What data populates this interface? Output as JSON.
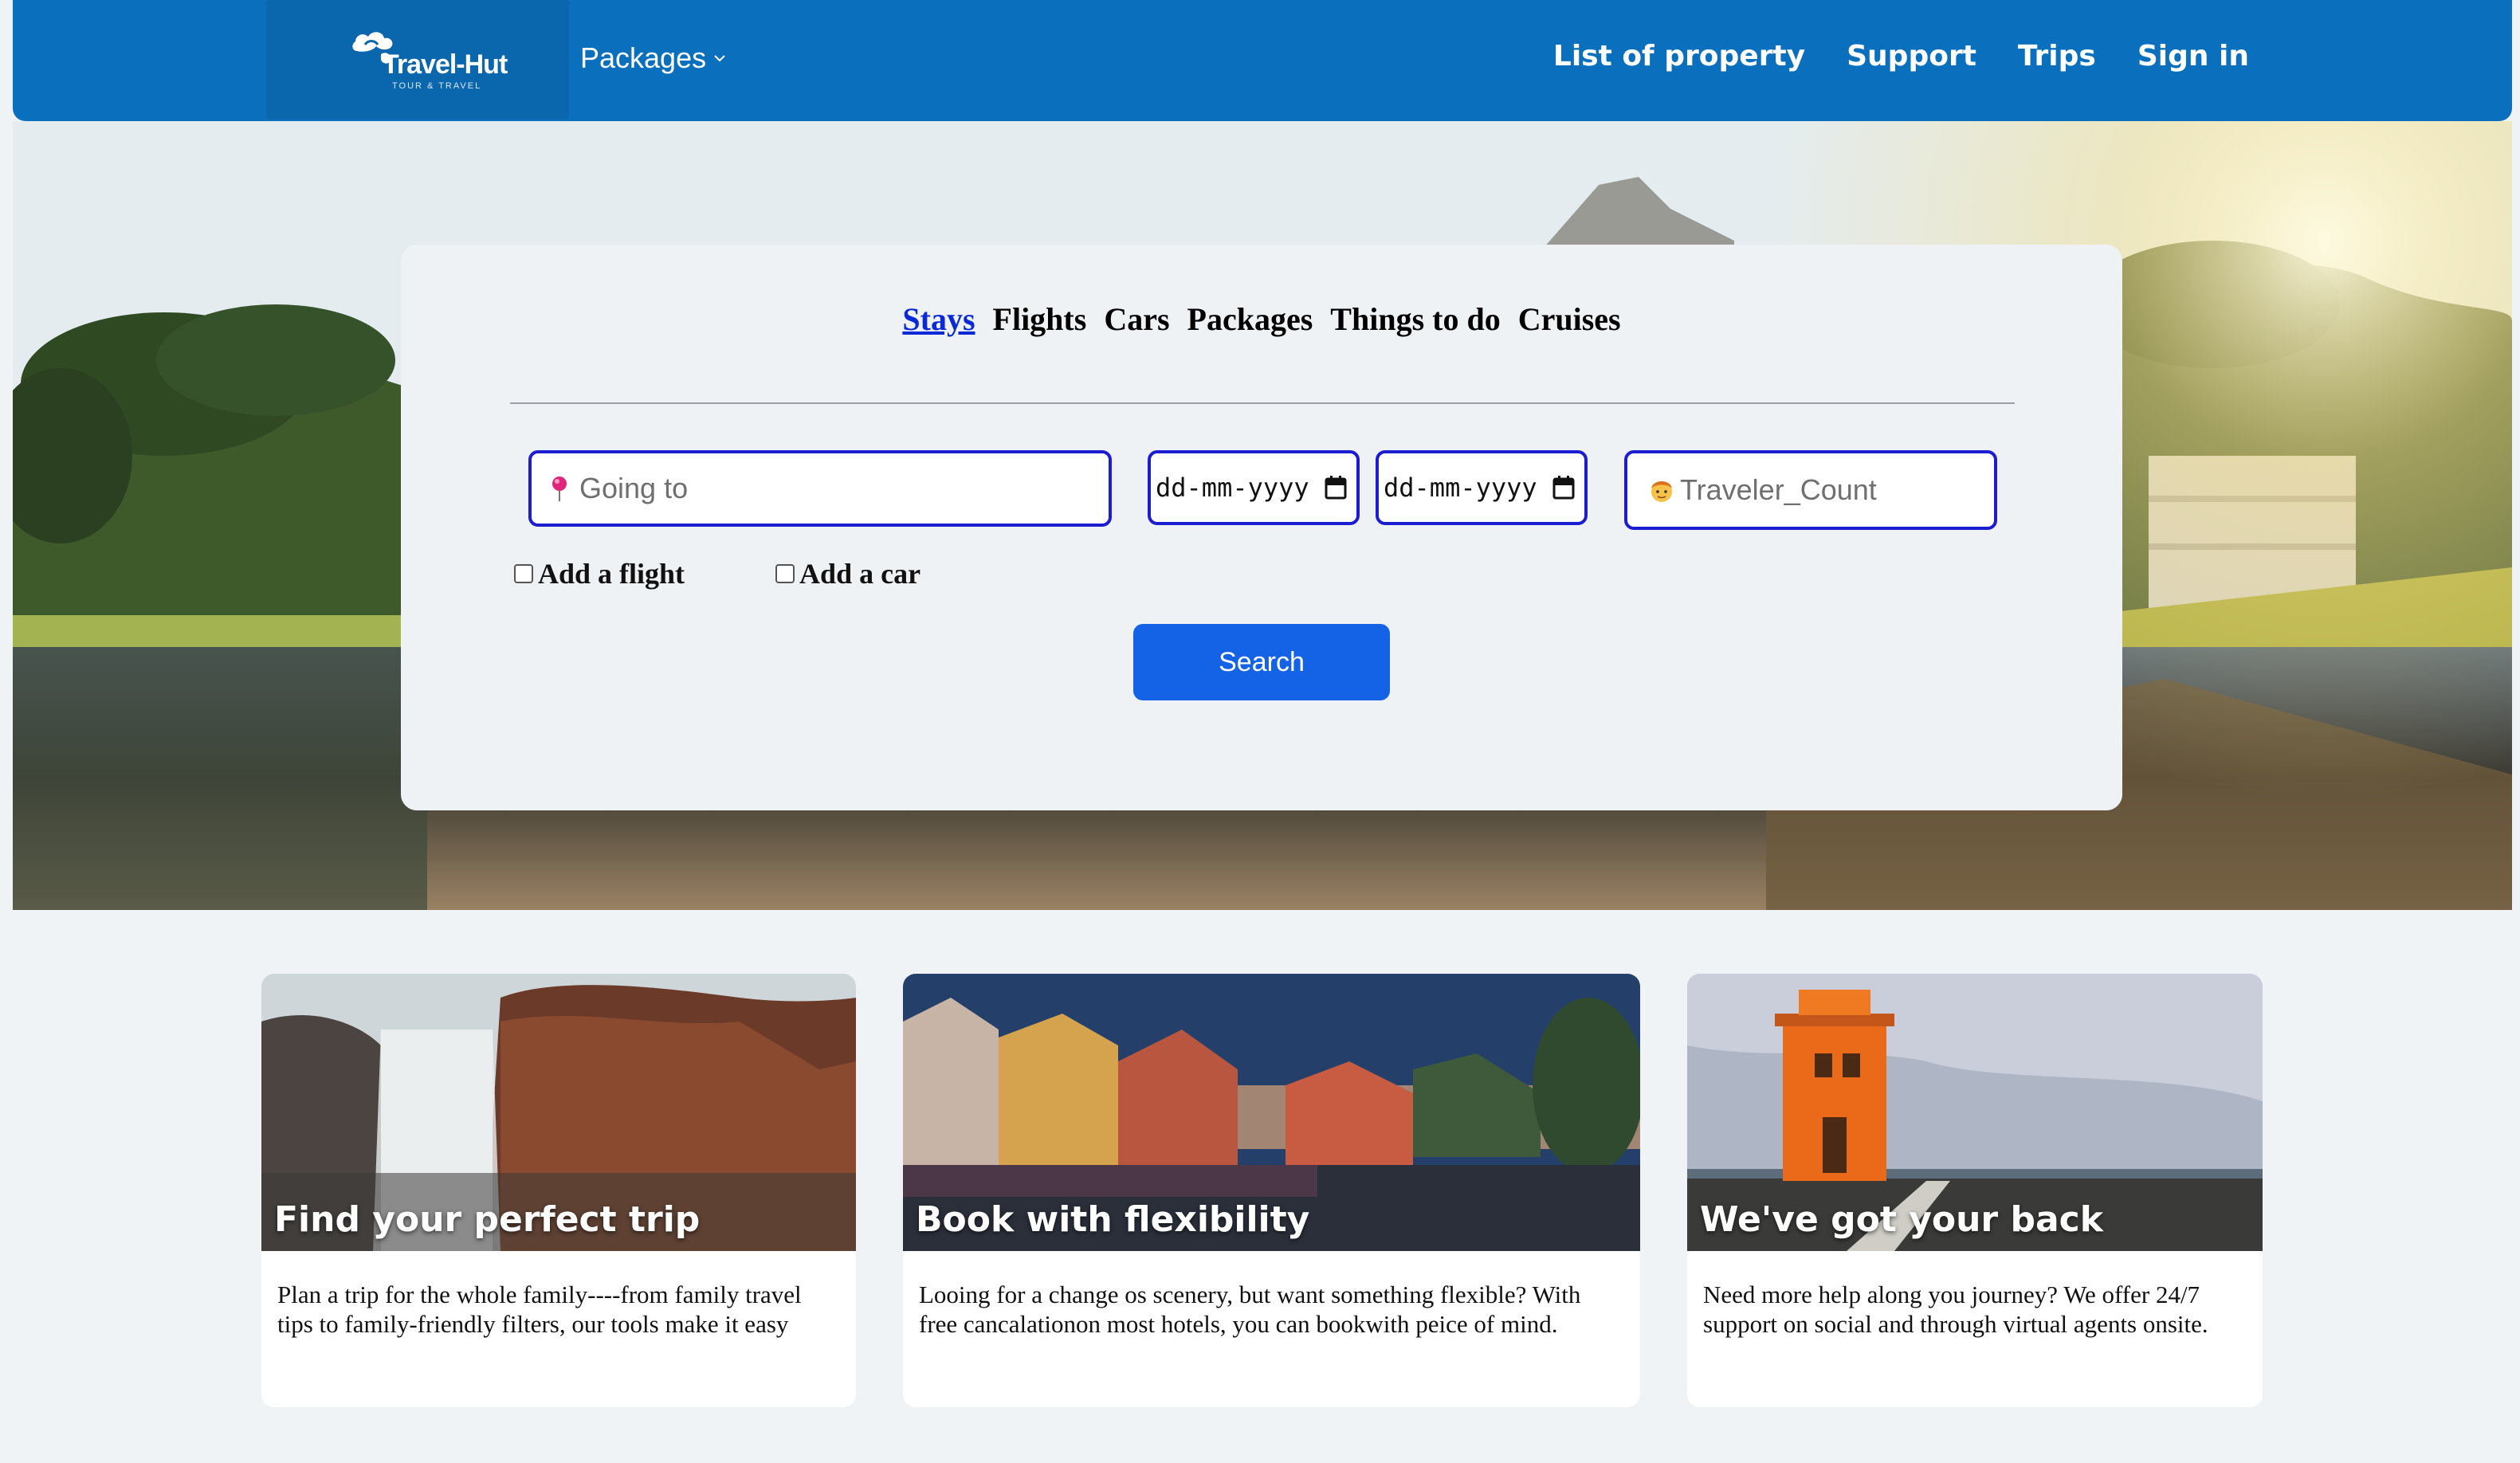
{
  "header": {
    "logo_text": "Travel-Hut",
    "logo_subtext": "TOUR & TRAVEL",
    "packages_label": "Packages",
    "nav_links": [
      "List of property",
      "Support",
      "Trips",
      "Sign in"
    ]
  },
  "search": {
    "tabs": [
      "Stays",
      "Flights",
      "Cars",
      "Packages",
      "Things to do",
      "Cruises"
    ],
    "active_tab": "Stays",
    "going_placeholder": "Going to",
    "date_placeholder_1": "dd-mm-yyyy",
    "date_placeholder_2": "dd-mm-yyyy",
    "traveler_placeholder": "Traveler_Count",
    "add_flight_label": "Add a flight",
    "add_car_label": "Add a car",
    "search_button": "Search"
  },
  "cards": [
    {
      "title": "Find your perfect trip",
      "text": "Plan a trip for the whole family----from family travel tips to family-friendly filters, our tools make it easy"
    },
    {
      "title": "Book with flexibility",
      "text": "Looing for a change os scenery, but want something flexible? With free cancalationon most hotels, you can bookwith peice of mind."
    },
    {
      "title": "We've got your back",
      "text": "Need more help along you journey? We offer 24/7 support on social and through virtual agents onsite."
    }
  ],
  "colors": {
    "nav_bg": "#0a70bd",
    "accent": "#1463e6",
    "field_border": "#1c1cd0"
  }
}
